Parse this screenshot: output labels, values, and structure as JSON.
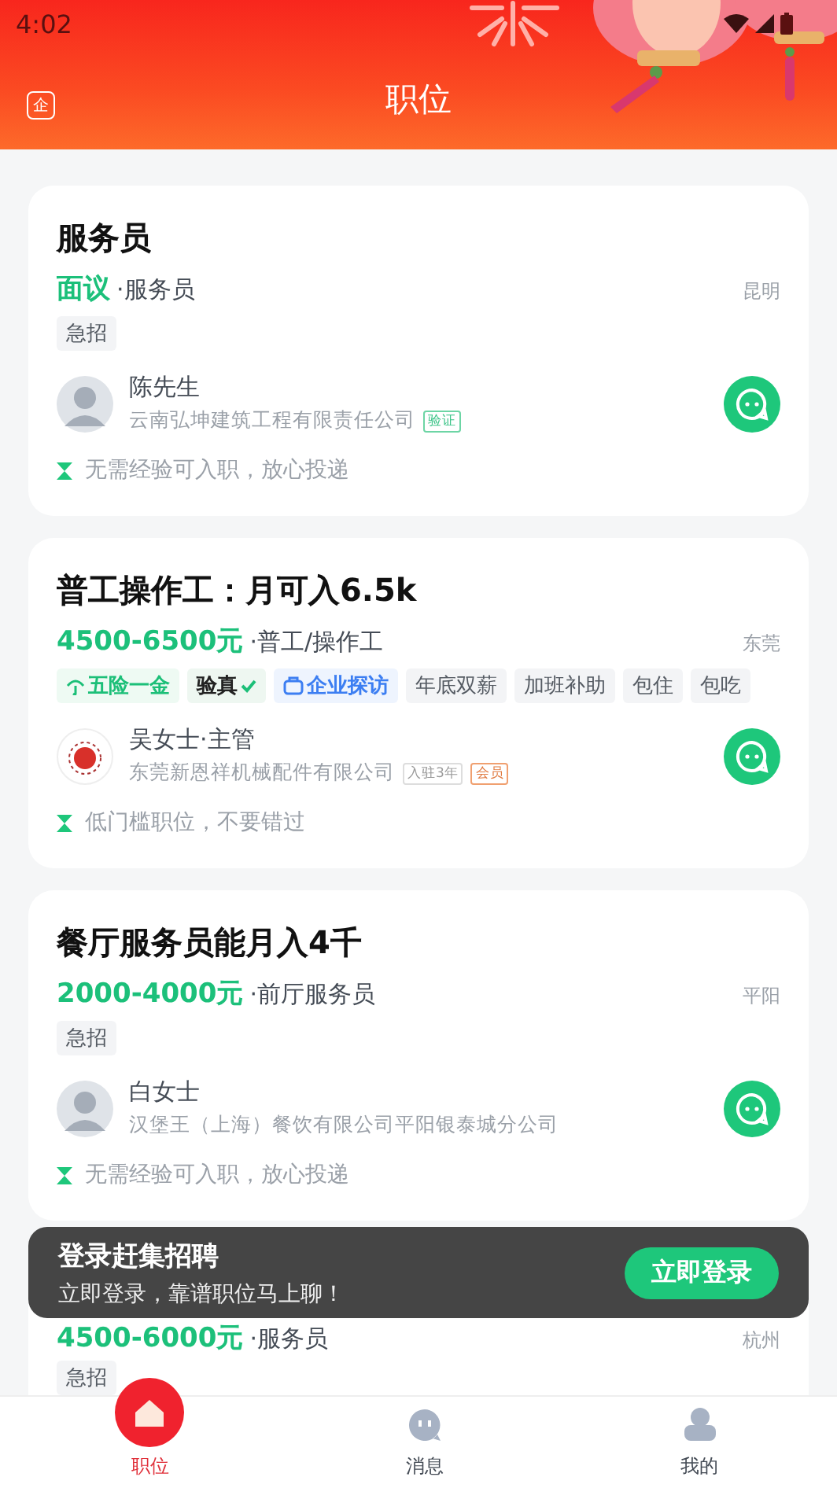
{
  "status_bar": {
    "time": "4:02"
  },
  "header": {
    "title": "职位",
    "left_icon_text": "企"
  },
  "jobs": [
    {
      "title": "服务员",
      "salary": "面议",
      "category": "·服务员",
      "city": "昆明",
      "tags": [
        {
          "kind": "plain",
          "label": "急招"
        }
      ],
      "recruiter": {
        "name": "陈先生",
        "kind": "person",
        "company": "云南弘坤建筑工程有限责任公司",
        "badges": [
          {
            "kind": "verified",
            "label": "验证"
          }
        ]
      },
      "note": "无需经验可入职，放心投递"
    },
    {
      "title": "普工操作工：月可入6.5k",
      "salary": "4500-6500元",
      "category": "·普工/操作工",
      "city": "东莞",
      "tags": [
        {
          "kind": "insurance",
          "label": "五险一金"
        },
        {
          "kind": "check",
          "label": "验真"
        },
        {
          "kind": "visit",
          "label": "企业探访"
        },
        {
          "kind": "plain",
          "label": "年底双薪"
        },
        {
          "kind": "plain",
          "label": "加班补助"
        },
        {
          "kind": "plain",
          "label": "包住"
        },
        {
          "kind": "plain",
          "label": "包吃"
        }
      ],
      "recruiter": {
        "name": "吴女士·主管",
        "kind": "logo",
        "company": "东莞新恩祥机械配件有限公司",
        "badges": [
          {
            "kind": "plain",
            "label": "入驻3年"
          },
          {
            "kind": "member",
            "label": "会员"
          }
        ]
      },
      "note": "低门槛职位，不要错过"
    },
    {
      "title": "餐厅服务员能月入4千",
      "salary": "2000-4000元",
      "category": "·前厅服务员",
      "city": "平阳",
      "tags": [
        {
          "kind": "plain",
          "label": "急招"
        }
      ],
      "recruiter": {
        "name": "白女士",
        "kind": "person",
        "company": "汉堡王（上海）餐饮有限公司平阳银泰城分公司"
      },
      "note": "无需经验可入职，放心投递"
    },
    {
      "salary": "4500-6000元",
      "category": "·服务员",
      "city": "杭州",
      "tags": [
        {
          "kind": "plain",
          "label": "急招"
        }
      ]
    }
  ],
  "login_toast": {
    "title": "登录赶集招聘",
    "subtitle": "立即登录，靠谱职位马上聊！",
    "button": "立即登录"
  },
  "tab_bar": [
    {
      "label": "职位",
      "selected": true
    },
    {
      "label": "消息",
      "selected": false
    },
    {
      "label": "我的",
      "selected": false
    }
  ]
}
